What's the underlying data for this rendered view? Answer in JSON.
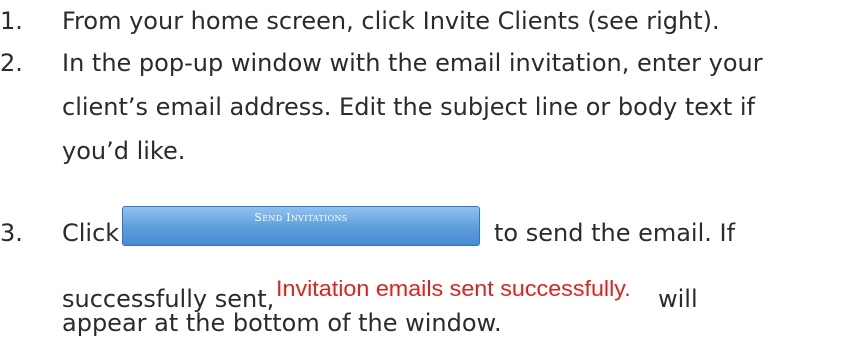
{
  "steps": [
    {
      "number": "1.",
      "lines": [
        "From your home screen, click Invite Clients (see right)."
      ]
    },
    {
      "number": "2.",
      "lines": [
        "In the pop-up window with the email invitation, enter your",
        "client’s email address. Edit the subject line or body text if",
        "you’d like."
      ]
    },
    {
      "number": "3.",
      "before_button": "Click",
      "button_label": "Send Invitations",
      "after_button": "to send the email. If",
      "line2_prefix": "successfully sent,",
      "success_message": "Invitation emails sent successfully.",
      "line2_suffix": "will",
      "line3": "appear at the bottom of the window."
    }
  ],
  "colors": {
    "text": "#2b2b2b",
    "button": "#5d9ddd",
    "success": "#e0221c"
  }
}
